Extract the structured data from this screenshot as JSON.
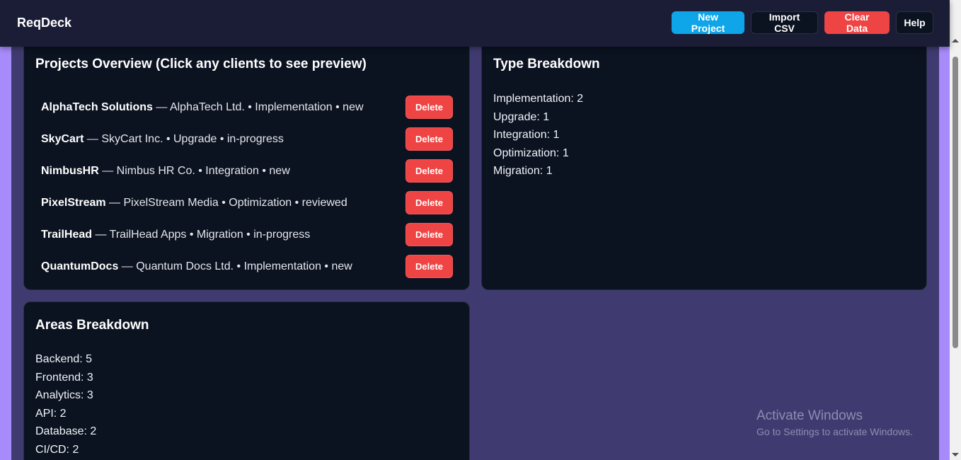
{
  "header": {
    "brand": "ReqDeck",
    "buttons": {
      "new_project": "New Project",
      "import_csv": "Import CSV",
      "clear_data": "Clear Data",
      "help": "Help"
    }
  },
  "projects": {
    "title": "Projects Overview (Click any clients to see preview)",
    "delete_label": "Delete",
    "items": [
      {
        "name": "AlphaTech Solutions",
        "details": " — AlphaTech Ltd. • Implementation • new"
      },
      {
        "name": "SkyCart",
        "details": " — SkyCart Inc. • Upgrade • in-progress"
      },
      {
        "name": "NimbusHR",
        "details": " — Nimbus HR Co. • Integration • new"
      },
      {
        "name": "PixelStream",
        "details": " — PixelStream Media • Optimization • reviewed"
      },
      {
        "name": "TrailHead",
        "details": " — TrailHead Apps • Migration • in-progress"
      },
      {
        "name": "QuantumDocs",
        "details": " — Quantum Docs Ltd. • Implementation • new"
      }
    ]
  },
  "type_breakdown": {
    "title": "Type Breakdown",
    "items": [
      "Implementation: 2",
      "Upgrade: 1",
      "Integration: 1",
      "Optimization: 1",
      "Migration: 1"
    ]
  },
  "areas_breakdown": {
    "title": "Areas Breakdown",
    "items": [
      "Backend: 5",
      "Frontend: 3",
      "Analytics: 3",
      "API: 2",
      "Database: 2",
      "CI/CD: 2"
    ]
  },
  "watermark": {
    "title": "Activate Windows",
    "subtitle": "Go to Settings to activate Windows."
  },
  "colors": {
    "accent": "#0ea5e9",
    "danger": "#ef4444",
    "card_bg": "#0b1220",
    "page_bg": "#3f3b70"
  }
}
